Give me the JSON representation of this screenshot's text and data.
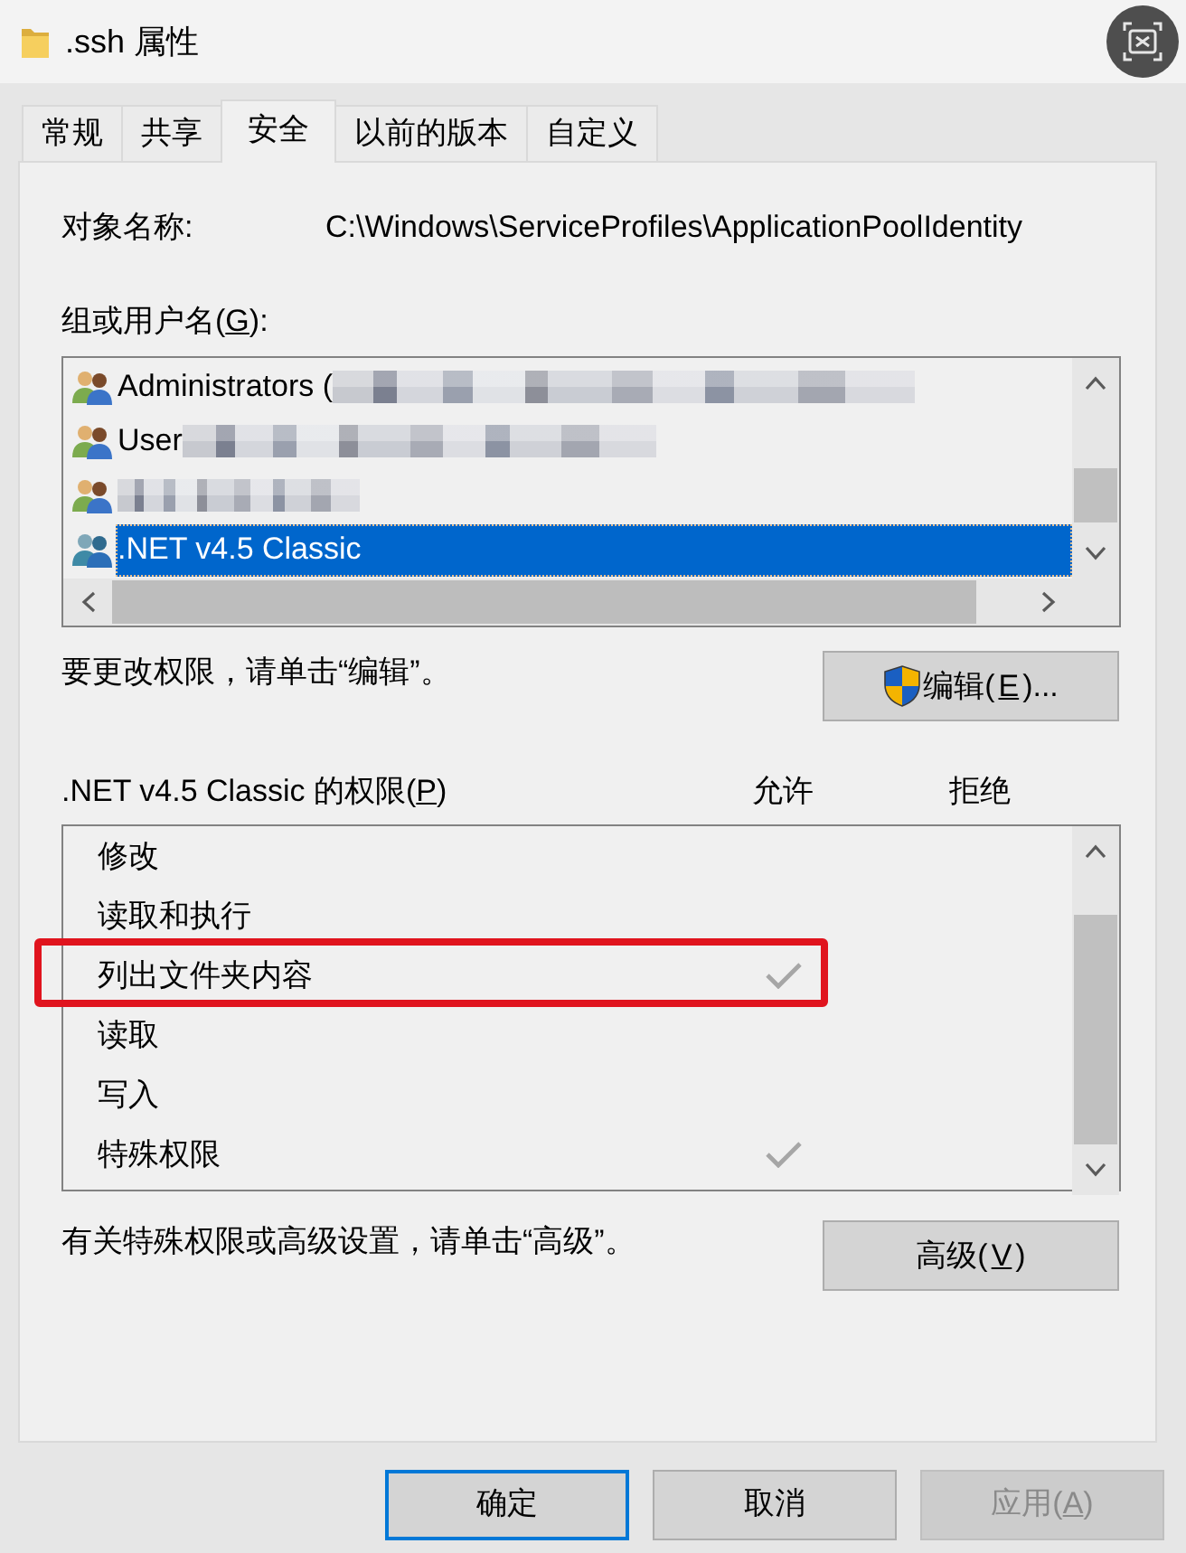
{
  "window": {
    "title": ".ssh 属性"
  },
  "tabs": [
    {
      "label": "常规",
      "selected": false
    },
    {
      "label": "共享",
      "selected": false
    },
    {
      "label": "安全",
      "selected": true
    },
    {
      "label": "以前的版本",
      "selected": false
    },
    {
      "label": "自定义",
      "selected": false
    }
  ],
  "object_name": {
    "label": "对象名称:",
    "value": "C:\\Windows\\ServiceProfiles\\ApplicationPoolIdentity"
  },
  "groups": {
    "label": "组或用户名(G):",
    "items": [
      {
        "name": "Administrators (",
        "blurred": true,
        "selected": false
      },
      {
        "name": "User",
        "blurred": true,
        "selected": false
      },
      {
        "blurred": true,
        "selected": false
      },
      {
        "name": ".NET v4.5 Classic",
        "blurred": false,
        "selected": true
      }
    ]
  },
  "edit": {
    "hint": "要更改权限，请单击“编辑”。",
    "button": {
      "label": "编辑(E)..."
    }
  },
  "permissions": {
    "title": ".NET v4.5 Classic 的权限(P)",
    "columns": [
      "允许",
      "拒绝"
    ],
    "rows": [
      {
        "name": "修改",
        "allow": false,
        "deny": false,
        "highlighted": false
      },
      {
        "name": "读取和执行",
        "allow": false,
        "deny": false,
        "highlighted": false
      },
      {
        "name": "列出文件夹内容",
        "allow": true,
        "deny": false,
        "highlighted": true
      },
      {
        "name": "读取",
        "allow": false,
        "deny": false,
        "highlighted": false
      },
      {
        "name": "写入",
        "allow": false,
        "deny": false,
        "highlighted": false
      },
      {
        "name": "特殊权限",
        "allow": true,
        "deny": false,
        "highlighted": false
      }
    ]
  },
  "advanced": {
    "hint": "有关特殊权限或高级设置，请单击“高级”。",
    "button": {
      "label": "高级(V)"
    }
  },
  "buttons": [
    {
      "label": "确定",
      "default": true,
      "disabled": false
    },
    {
      "label": "取消",
      "default": false,
      "disabled": false
    },
    {
      "label": "应用(A)",
      "default": false,
      "disabled": true
    }
  ]
}
